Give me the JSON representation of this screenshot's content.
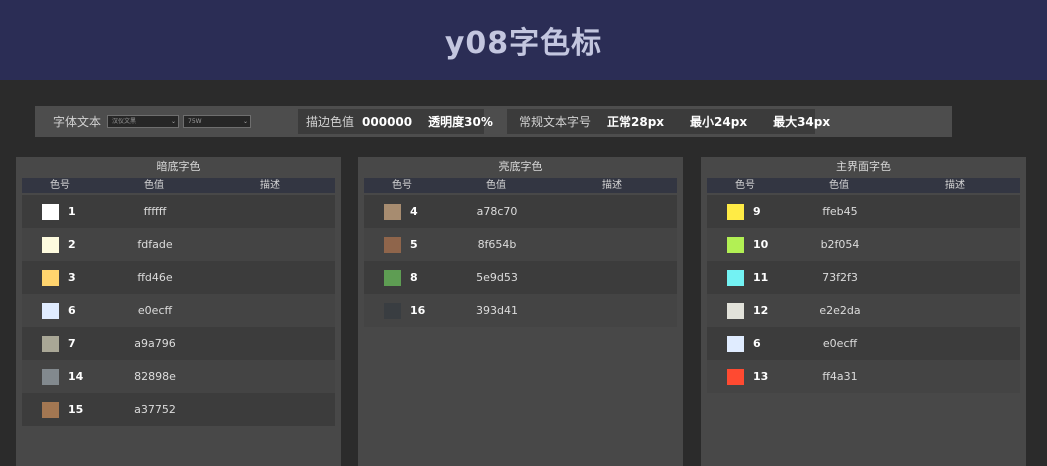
{
  "header": {
    "title": "y08字色标"
  },
  "toolbar": {
    "font_label": "字体文本",
    "font_select": "汉仪文黑",
    "weight_select": "75W",
    "stroke_label": "描边色值",
    "stroke_value": "000000",
    "opacity_value": "透明度30%",
    "size_label": "常规文本字号",
    "size_normal": "正常28px",
    "size_min": "最小24px",
    "size_max": "最大34px"
  },
  "columns": {
    "number": "色号",
    "value": "色值",
    "desc": "描述"
  },
  "panels": [
    {
      "title": "暗底字色",
      "rows": [
        {
          "num": "1",
          "hex": "ffffff",
          "color": "#ffffff"
        },
        {
          "num": "2",
          "hex": "fdfade",
          "color": "#fdfade"
        },
        {
          "num": "3",
          "hex": "ffd46e",
          "color": "#ffd46e"
        },
        {
          "num": "6",
          "hex": "e0ecff",
          "color": "#e0ecff"
        },
        {
          "num": "7",
          "hex": "a9a796",
          "color": "#a9a796"
        },
        {
          "num": "14",
          "hex": "82898e",
          "color": "#82898e"
        },
        {
          "num": "15",
          "hex": "a37752",
          "color": "#a37752"
        }
      ]
    },
    {
      "title": "亮底字色",
      "rows": [
        {
          "num": "4",
          "hex": "a78c70",
          "color": "#a78c70"
        },
        {
          "num": "5",
          "hex": "8f654b",
          "color": "#8f654b"
        },
        {
          "num": "8",
          "hex": "5e9d53",
          "color": "#5e9d53"
        },
        {
          "num": "16",
          "hex": "393d41",
          "color": "#393d41"
        }
      ]
    },
    {
      "title": "主界面字色",
      "rows": [
        {
          "num": "9",
          "hex": "ffeb45",
          "color": "#ffeb45"
        },
        {
          "num": "10",
          "hex": "b2f054",
          "color": "#b2f054"
        },
        {
          "num": "11",
          "hex": "73f2f3",
          "color": "#73f2f3"
        },
        {
          "num": "12",
          "hex": "e2e2da",
          "color": "#e2e2da"
        },
        {
          "num": "6",
          "hex": "e0ecff",
          "color": "#e0ecff"
        },
        {
          "num": "13",
          "hex": "ff4a31",
          "color": "#ff4a31"
        }
      ]
    }
  ]
}
